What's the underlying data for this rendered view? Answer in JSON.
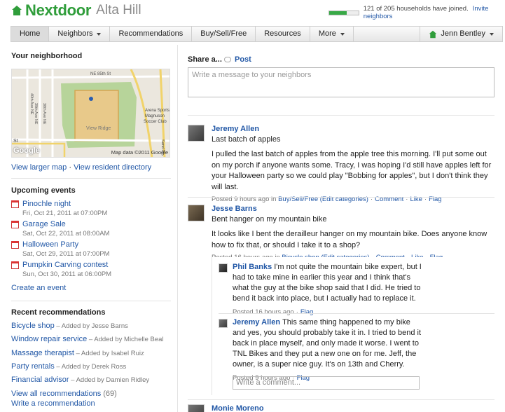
{
  "brand": {
    "name": "Nextdoor",
    "neighborhood": "Alta Hill"
  },
  "progress": {
    "fraction": 0.59,
    "label": "121 of 205 households have joined.",
    "invite": "Invite neighbors"
  },
  "nav": {
    "items": [
      {
        "label": "Home",
        "active": true,
        "dropdown": false
      },
      {
        "label": "Neighbors",
        "active": false,
        "dropdown": true
      },
      {
        "label": "Recommendations",
        "active": false,
        "dropdown": false
      },
      {
        "label": "Buy/Sell/Free",
        "active": false,
        "dropdown": false
      },
      {
        "label": "Resources",
        "active": false,
        "dropdown": false
      },
      {
        "label": "More",
        "active": false,
        "dropdown": true
      }
    ],
    "user": "Jenn Bentley"
  },
  "left": {
    "neighborhood_title": "Your neighborhood",
    "map": {
      "labels": [
        "NE 85th St",
        "40th Ave NE",
        "39th Ave NE",
        "38th Ave NE",
        "View Ridge",
        "Arena Sports",
        "Magnuson",
        "Soccer Club",
        "St",
        "Sand Pt"
      ],
      "google": "Google",
      "caption": "Map data ©2011 Google"
    },
    "map_links": {
      "larger": "View larger map",
      "sep": " · ",
      "directory": "View resident directory"
    },
    "events_title": "Upcoming events",
    "events": [
      {
        "name": "Pinochle night",
        "date": "Fri, Oct 21, 2011 at 07:00PM"
      },
      {
        "name": "Garage Sale",
        "date": "Sat, Oct 22, 2011 at 08:00AM"
      },
      {
        "name": "Halloween Party",
        "date": "Sat, Oct 29, 2011 at 07:00PM"
      },
      {
        "name": "Pumpkin Carving contest",
        "date": "Sun, Oct 30, 2011 at 06:00PM"
      }
    ],
    "create_event": "Create an event",
    "recs_title": "Recent recommendations",
    "recs": [
      {
        "name": "Bicycle shop",
        "by": " – Added by ",
        "person": "Jesse Barns"
      },
      {
        "name": "Window repair service",
        "by": " – Added by ",
        "person": "Michelle Beal"
      },
      {
        "name": "Massage therapist",
        "by": " – Added by ",
        "person": "Isabel Ruiz"
      },
      {
        "name": "Party rentals",
        "by": " – Added by ",
        "person": "Derek Ross"
      },
      {
        "name": "Financial advisor",
        "by": " – Added by ",
        "person": "Damien Ridley"
      }
    ],
    "view_all": "View all recommendations",
    "view_all_count": "(69)",
    "write_rec": "Write a recommendation"
  },
  "share": {
    "label": "Share a...",
    "post_tab": "Post",
    "placeholder": "Write a message to your neighbors"
  },
  "posts": [
    {
      "author": "Jeremy Allen",
      "subject": "Last batch of apples",
      "text": "I pulled the last batch of apples from the apple tree this morning. I'll put some out on my porch if anyone wants some. Tracy, I was hoping I'd still have apples left for your Halloween party so we could play \"Bobbing for apples\", but I don't think they will last.",
      "posted": "Posted 9 hours ago in",
      "category": "Buy/Sell/Free",
      "edit": "(Edit categories)",
      "comment": "Comment",
      "like": "Like",
      "flag": "Flag"
    },
    {
      "author": "Jesse Barns",
      "subject": "Bent hanger on my mountain bike",
      "text": "It looks like I bent the derailleur hanger on my mountain bike. Does anyone know how to fix that, or should I take it to a shop?",
      "posted": "Posted 16 hours ago in",
      "category": "Bicycle shop",
      "edit": "(Edit categories)",
      "comment": "Comment",
      "like": "Like",
      "flag": "Flag"
    },
    {
      "author": "Monie Moreno"
    }
  ],
  "replies": [
    {
      "author": "Phil Banks",
      "text": "I'm not quite the mountain bike expert, but I had to take mine in earlier this year and I think that's what the guy at the bike shop said that I did. He tried to bend it back into place, but I actually had to replace it.",
      "posted": "Posted 16 hours ago",
      "flag": "Flag"
    },
    {
      "author": "Jeremy Allen",
      "text": "This same thing happened to my bike and yes, you should probably take it in. I tried to bend it back in place myself, and only made it worse. I went to TNL Bikes and they put a new one on for me. Jeff, the owner, is a super nice guy. It's on 13th and Cherry.",
      "posted": "Posted 9 hours ago",
      "flag": "Flag"
    }
  ],
  "comment_placeholder": "Write a comment...",
  "colors": {
    "brand_green": "#2f9d3a",
    "link_blue": "#2157a6",
    "event_red": "#d33333"
  }
}
